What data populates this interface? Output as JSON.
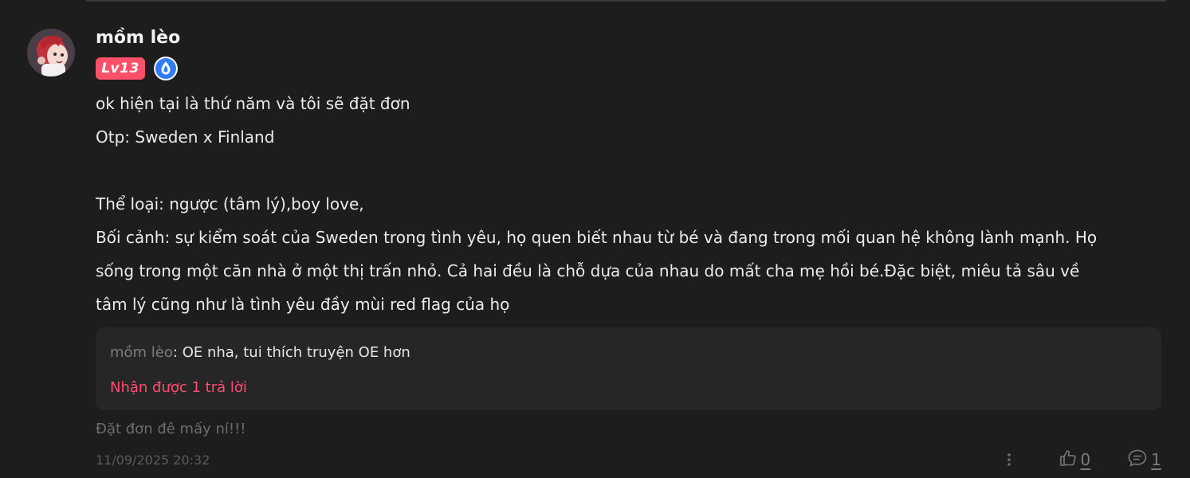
{
  "comment": {
    "author": "mồm lèo",
    "level": "Lv13",
    "lines": [
      "ok hiện tại là thứ năm và tôi sẽ đặt đơn",
      "Otp: Sweden x Finland",
      "",
      "Thể loại: ngược (tâm lý),boy love,",
      "Bối cảnh: sự kiểm soát của Sweden trong tình yêu, họ quen biết nhau từ bé và đang trong mối quan hệ không lành mạnh. Họ",
      "sống trong một căn nhà ở một thị trấn nhỏ. Cả hai đều là chỗ dựa của nhau do mất cha mẹ hồi bé.Đặc biệt, miêu tả sâu về",
      "tâm lý cũng như là tình yêu đầy mùi red flag của họ"
    ],
    "reply_preview": {
      "author": "mồm lèo",
      "separator": ": ",
      "text": "OE nha, tui thích truyện OE hơn"
    },
    "reply_count_label": "Nhận được 1 trả lời",
    "subtitle": "Đặt đơn đê mấy ní!!!",
    "timestamp": "11/09/2025 20:32",
    "likes": "0",
    "replies": "1"
  },
  "icons": {
    "more": "more-vertical-icon",
    "like": "thumbs-up-icon",
    "reply": "comment-bubble-icon",
    "shield": "shield-badge-icon"
  },
  "colors": {
    "background": "#1d1d1d",
    "reply_box": "#262626",
    "accent": "#ff4f6e",
    "level_badge": "#ff5069",
    "shield_badge": "#2f7df6"
  }
}
